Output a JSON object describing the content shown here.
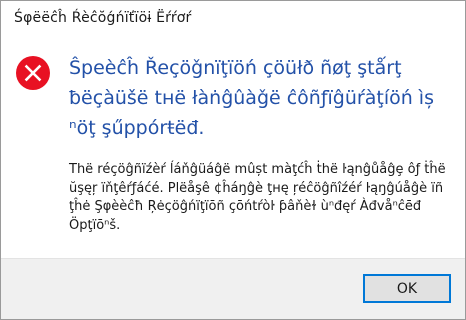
{
  "window": {
    "title": "Śφëëĉĥ Ŕèĉŏǵńïťïöɨ Ëŕŕơŕ"
  },
  "message": {
    "icon": "error-icon",
    "heading": "Ŝpeèĉĥ Řeçöǧnïţïöń çöüłð ñøţ ştǻrţ ƀëçàüšë tнë łàṅĝûàǧë ĉôñƒïĝüŕàţíöń ìș ⁿöţ şűppórŧëđ.",
    "body": "Thë réçöĝñïźèŕ ĺáňĝüáĝë mûșt màţćĥ ṫhë ŀąnĝůåĝȩ ôƒ ṫĥë ŭşęŗ ïňţêŕƒáćé.  Plëåşê ¢ĥáŋĝè ţнę ŗéĉöĝñîźéŕ ŀąŋĝúåĝè ïñ ţĥė Şφèèĉħ Ŗėçöĝńïţïōñ çōńtŕòŀ ƥâňèɫ ùⁿđęŕ Àđvåⁿĉēđ Öpţïōⁿš.",
    "icon_colors": {
      "circle": "#e81123",
      "cross": "#ffffff"
    },
    "heading_color": "#2351a8"
  },
  "footer": {
    "ok_label": "OK"
  }
}
